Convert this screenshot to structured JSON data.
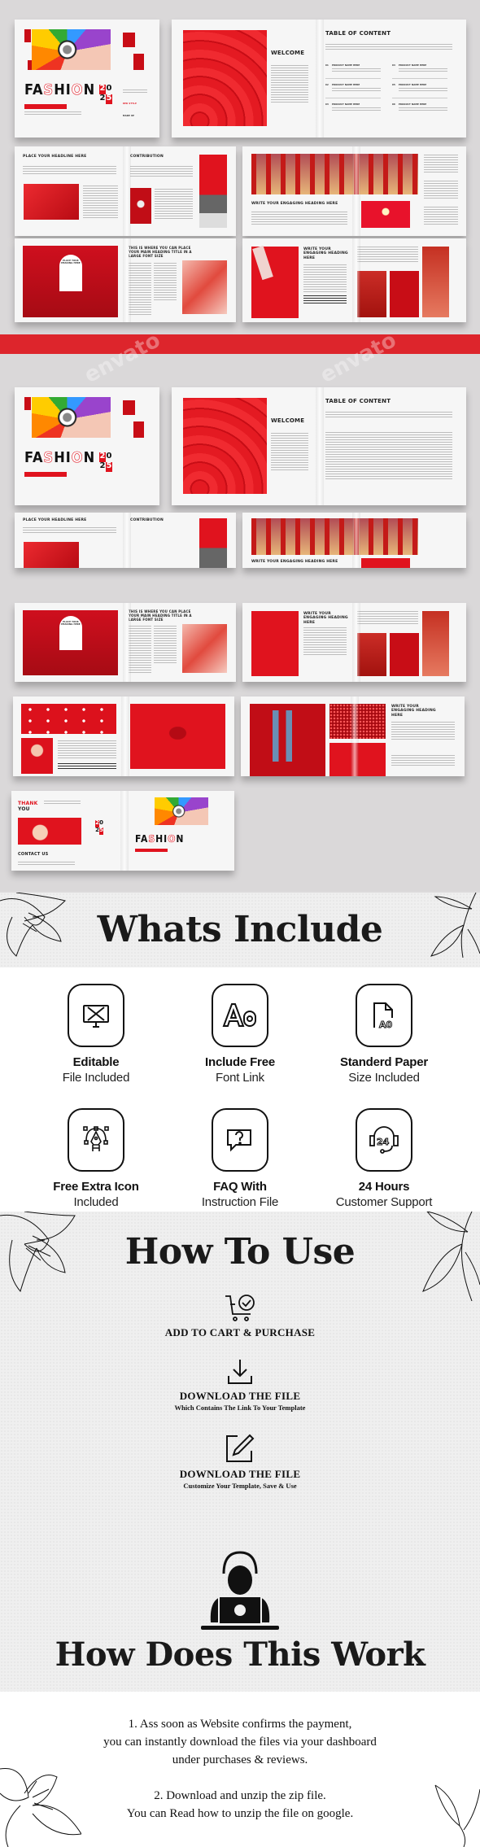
{
  "mockup": {
    "cover": {
      "title_left": "FA",
      "title_s": "S",
      "title_hi": "HI",
      "title_o": "O",
      "title_n": "N",
      "tagline": "ISSUE 023 / SPECIAL EDITION / MAY 2023",
      "year": [
        "2",
        "0",
        "2",
        "5"
      ],
      "side_labels": [
        "RED STYLE",
        "MAKE UP"
      ]
    },
    "welcome_title": "WELCOME",
    "toc_title": "TABLE OF CONTENT",
    "toc_items": [
      "01",
      "02",
      "03",
      "04",
      "05",
      "06"
    ],
    "toc_item_label": "PRODUCT NAME HERE",
    "spread2_left_title": "PLACE YOUR HEADLINE HERE",
    "spread2_right_title": "CONTRIBUTION",
    "spread3_title": "WRITE YOUR ENGAGING HEADING HERE",
    "spread4_title": "THIS IS WHERE YOU CAN PLACE YOUR MAIN HEADING TITLE IN A LARGE FONT SIZE",
    "spread4_arch": "PLACE YOUR HEADING HERE",
    "spread5_title": "WRITE YOUR ENGAGING HEADING HERE",
    "spread8_title": "WRITE YOUR ENGAGING HEADING HERE",
    "thank_you": [
      "THANK",
      "YOU"
    ],
    "contact_us": "CONTACT US",
    "watermark": "envato"
  },
  "whats_include": {
    "title": "Whats Include",
    "items": [
      {
        "icon": "editable-monitor-icon",
        "line1": "Editable",
        "line2": "File Included"
      },
      {
        "icon": "font-aa-icon",
        "line1": "Include Free",
        "line2": "Font Link"
      },
      {
        "icon": "paper-a0-icon",
        "line1": "Standerd Paper",
        "line2": "Size Included"
      },
      {
        "icon": "pen-tool-icon",
        "line1": "Free Extra Icon",
        "line2": "Included"
      },
      {
        "icon": "faq-chat-icon",
        "line1": "FAQ With",
        "line2": "Instruction File"
      },
      {
        "icon": "support-24-icon",
        "line1": "24 Hours",
        "line2": "Customer Support"
      }
    ]
  },
  "how_to_use": {
    "title": "How To Use",
    "steps": [
      {
        "icon": "cart-check-icon",
        "title": "ADD TO CART & PURCHASE",
        "subtitle": ""
      },
      {
        "icon": "download-icon",
        "title": "DOWNLOAD THE FILE",
        "subtitle": "Which Contains The Link To Your Template"
      },
      {
        "icon": "edit-icon",
        "title": "DOWNLOAD THE FILE",
        "subtitle": "Customize Your Template, Save & Use"
      }
    ]
  },
  "how_does_this_work": {
    "title": "How Does This Work",
    "paragraphs": [
      [
        "1. Ass soon as Website confirms the payment,",
        "you can instantly download the files via your dashboard",
        "under purchases & reviews."
      ],
      [
        "2. Download and unzip the zip file.",
        "You can Read how to unzip the file on google."
      ]
    ]
  },
  "colors": {
    "accent": "#e0131e",
    "banner": "#dd252c",
    "text": "#111111"
  }
}
